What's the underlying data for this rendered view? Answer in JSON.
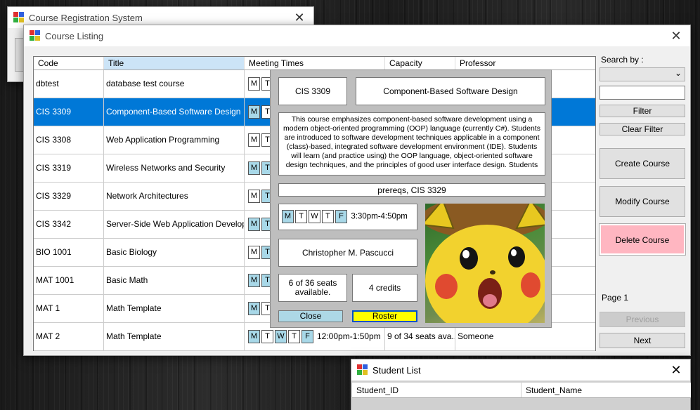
{
  "registration_window": {
    "title": "Course Registration System"
  },
  "listing_window": {
    "title": "Course Listing",
    "columns": [
      "Code",
      "Title",
      "Meeting Times",
      "Capacity",
      "Professor"
    ],
    "rows": [
      {
        "code": "dbtest",
        "title": "database test course",
        "days": [
          "M",
          "T"
        ],
        "on": [
          0,
          0
        ]
      },
      {
        "code": "CIS 3309",
        "title": "Component-Based Software Design",
        "days": [
          "M",
          "T"
        ],
        "on": [
          1,
          0
        ]
      },
      {
        "code": "CIS 3308",
        "title": "Web Application Programming",
        "days": [
          "M",
          "T"
        ],
        "on": [
          0,
          0
        ]
      },
      {
        "code": "CIS 3319",
        "title": "Wireless Networks and Security",
        "days": [
          "M",
          "T"
        ],
        "on": [
          1,
          1
        ]
      },
      {
        "code": "CIS 3329",
        "title": "Network Architectures",
        "days": [
          "M",
          "T"
        ],
        "on": [
          0,
          1
        ]
      },
      {
        "code": "CIS 3342",
        "title": "Server-Side Web Application Develop...",
        "days": [
          "M",
          "T"
        ],
        "on": [
          1,
          1
        ]
      },
      {
        "code": "BIO 1001",
        "title": "Basic Biology",
        "days": [
          "M",
          "T"
        ],
        "on": [
          0,
          1
        ]
      },
      {
        "code": "MAT 1001",
        "title": "Basic Math",
        "days": [
          "M",
          "T"
        ],
        "on": [
          1,
          1
        ]
      },
      {
        "code": "MAT 1",
        "title": "Math Template",
        "days": [
          "M",
          "T"
        ],
        "on": [
          1,
          0
        ]
      },
      {
        "code": "MAT 2",
        "title": "Math Template",
        "days": [
          "M",
          "T",
          "W",
          "T",
          "F"
        ],
        "on": [
          1,
          0,
          1,
          0,
          1
        ],
        "time": "12:00pm-1:50pm",
        "capacity": "9 of 34 seats ava...",
        "professor": "Someone"
      }
    ],
    "sidebar": {
      "search_by_label": "Search by :",
      "search_by_value": "",
      "search_value": "",
      "filter_label": "Filter",
      "clear_filter_label": "Clear Filter",
      "create_label": "Create Course",
      "modify_label": "Modify Course",
      "delete_label": "Delete Course",
      "page_label": "Page 1",
      "previous_label": "Previous",
      "next_label": "Next"
    }
  },
  "detail": {
    "code": "CIS 3309",
    "title": "Component-Based Software Design",
    "description": "This course emphasizes component-based software development using a modern object-oriented programming (OOP) language (currently C#). Students are introduced to software development techniques applicable in a component (class)-based, integrated software development environment (IDE). Students will learn (and practice using) the OOP language, object-oriented software design techniques, and the principles of good user interface design. Students",
    "prereqs": "prereqs, CIS 3329",
    "days": [
      "M",
      "T",
      "W",
      "T",
      "F"
    ],
    "on": [
      1,
      0,
      0,
      0,
      1
    ],
    "time": "3:30pm-4:50pm",
    "professor": "Christopher M. Pascucci",
    "seats": "6 of 36 seats available.",
    "credits": "4 credits",
    "close_label": "Close",
    "roster_label": "Roster",
    "image_icon": "surprised-pikachu-image"
  },
  "student_window": {
    "title": "Student List",
    "columns": [
      "Student_ID",
      "Student_Name"
    ]
  },
  "colors": {
    "selection": "#0078d7",
    "header_highlight": "#cce4f7",
    "day_on": "#a8d8e8",
    "delete": "#ffb6c1",
    "roster": "#ffff00",
    "close": "#add8e6"
  }
}
